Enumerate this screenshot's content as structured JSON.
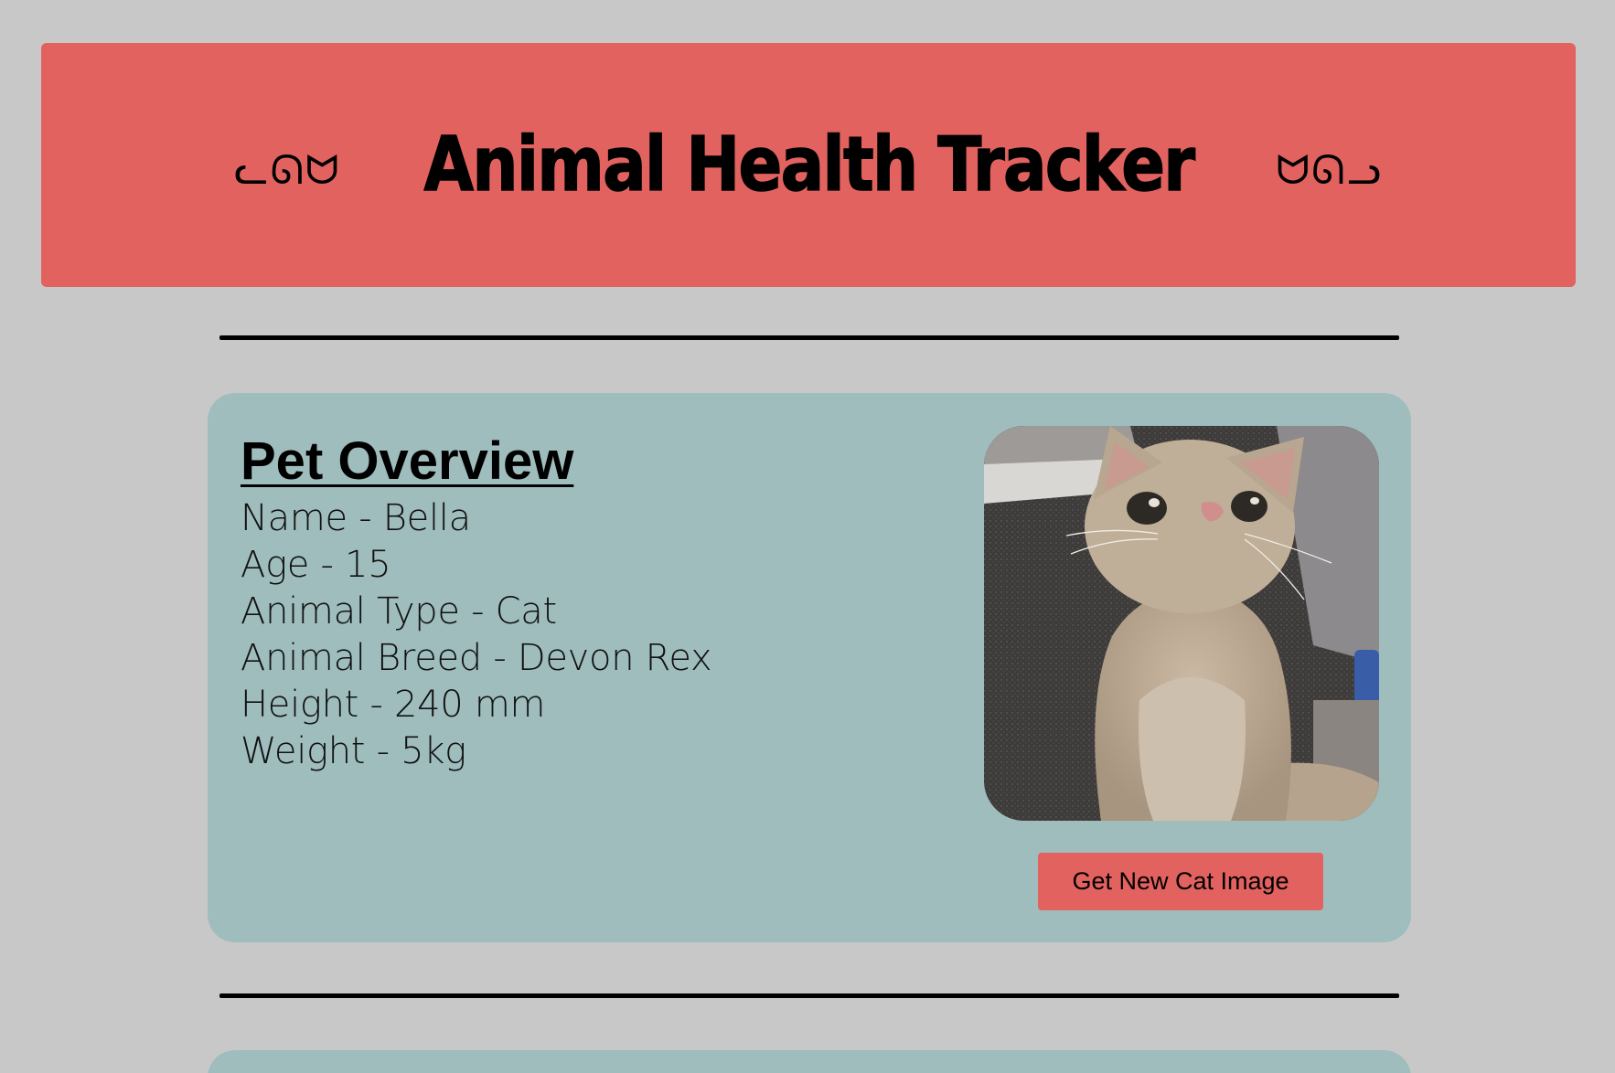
{
  "header": {
    "kaomoji_left": "ᓚᘏᗢ",
    "title": "Animal Health Tracker",
    "kaomoji_right": "ᗢᘏᓗ"
  },
  "pet_overview": {
    "heading": "Pet Overview",
    "details": [
      "Name - Bella",
      "Age - 15",
      "Animal Type - Cat",
      "Animal Breed - Devon Rex",
      "Height - 240 mm",
      "Weight - 5kg"
    ],
    "image_icon": "cat-photo",
    "button_label": "Get New Cat Image"
  },
  "colors": {
    "background": "#c8c8c8",
    "header": "#e2625f",
    "card": "#9fbdbd",
    "button": "#e2625f"
  }
}
